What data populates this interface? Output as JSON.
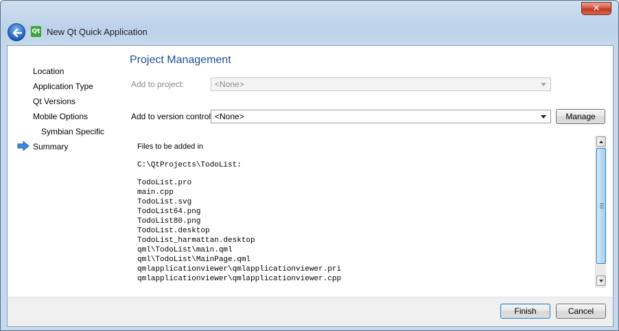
{
  "window": {
    "title": "New Qt Quick Application",
    "close_glyph": "✕",
    "logo_text": "Qt"
  },
  "nav": {
    "items": [
      {
        "label": "Location"
      },
      {
        "label": "Application Type"
      },
      {
        "label": "Qt Versions"
      },
      {
        "label": "Mobile Options"
      },
      {
        "label": "Symbian Specific"
      },
      {
        "label": "Summary",
        "current": true
      }
    ],
    "current_indicator_icon": "arrow-right-icon"
  },
  "page": {
    "title": "Project Management",
    "add_to_project_label": "Add to project:",
    "add_to_project_value": "<None>",
    "add_to_vcs_label": "Add to version control:",
    "add_to_vcs_value": "<None>",
    "manage_label": "Manage"
  },
  "files": {
    "heading": "Files to be added in",
    "directory": "C:\\QtProjects\\TodoList:",
    "list": [
      "TodoList.pro",
      "main.cpp",
      "TodoList.svg",
      "TodoList64.png",
      "TodoList80.png",
      "TodoList.desktop",
      "TodoList_harmattan.desktop",
      "qml\\TodoList\\main.qml",
      "qml\\TodoList\\MainPage.qml",
      "qmlapplicationviewer\\qmlapplicationviewer.pri",
      "qmlapplicationviewer\\qmlapplicationviewer.cpp"
    ]
  },
  "footer": {
    "finish_label": "Finish",
    "cancel_label": "Cancel"
  },
  "colors": {
    "title_blue": "#1f4e96",
    "arrow_blue": "#3d8be0"
  }
}
